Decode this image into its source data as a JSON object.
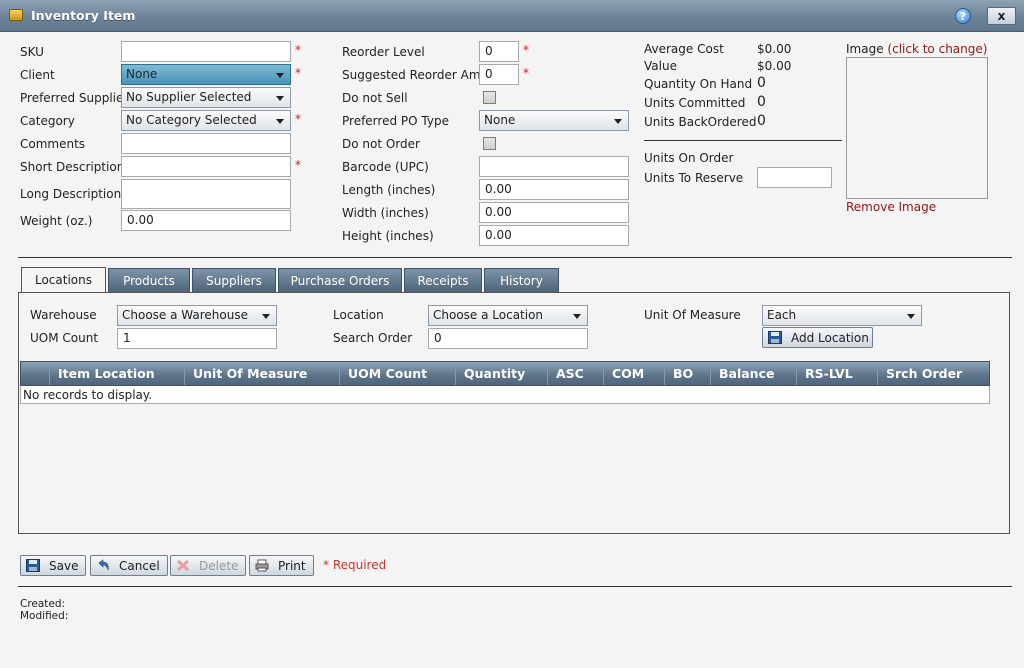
{
  "window": {
    "title": "Inventory Item",
    "help_label": "?",
    "close_label": "x"
  },
  "form": {
    "sku": {
      "label": "SKU",
      "value": ""
    },
    "client": {
      "label": "Client",
      "value": "None"
    },
    "preferred_supplier": {
      "label": "Preferred Supplier",
      "value": "No Supplier Selected"
    },
    "category": {
      "label": "Category",
      "value": "No Category Selected"
    },
    "comments": {
      "label": "Comments",
      "value": ""
    },
    "short_description": {
      "label": "Short Description",
      "value": ""
    },
    "long_description": {
      "label": "Long Description",
      "value": ""
    },
    "weight": {
      "label": "Weight (oz.)",
      "value": "0.00"
    },
    "required_mark": "*",
    "reorder_level": {
      "label": "Reorder Level",
      "value": "0"
    },
    "suggested_reorder_amt": {
      "label": "Suggested Reorder Amt",
      "value": "0"
    },
    "do_not_sell": {
      "label": "Do not Sell",
      "checked": false
    },
    "preferred_po_type": {
      "label": "Preferred PO Type",
      "value": "None"
    },
    "do_not_order": {
      "label": "Do not Order",
      "checked": false
    },
    "barcode": {
      "label": "Barcode (UPC)",
      "value": ""
    },
    "length": {
      "label": "Length (inches)",
      "value": "0.00"
    },
    "width": {
      "label": "Width (inches)",
      "value": "0.00"
    },
    "height": {
      "label": "Height (inches)",
      "value": "0.00"
    }
  },
  "stats": {
    "average_cost": {
      "label": "Average Cost",
      "value": "$0.00"
    },
    "value": {
      "label": "Value",
      "value": "$0.00"
    },
    "quantity_on_hand": {
      "label": "Quantity On Hand",
      "value": "0"
    },
    "units_committed": {
      "label": "Units Committed",
      "value": "0"
    },
    "units_backordered": {
      "label": "Units BackOrdered",
      "value": "0"
    },
    "units_on_order": {
      "label": "Units On Order"
    },
    "units_to_reserve": {
      "label": "Units To Reserve",
      "value": ""
    }
  },
  "image": {
    "label": "Image",
    "change_link": "(click to change)",
    "remove_link": "Remove Image"
  },
  "tabs": [
    {
      "label": "Locations",
      "selected": true
    },
    {
      "label": "Products"
    },
    {
      "label": "Suppliers"
    },
    {
      "label": "Purchase Orders"
    },
    {
      "label": "Receipts"
    },
    {
      "label": "History"
    }
  ],
  "locations": {
    "warehouse": {
      "label": "Warehouse",
      "value": "Choose a Warehouse"
    },
    "uom_count": {
      "label": "UOM Count",
      "value": "1"
    },
    "location": {
      "label": "Location",
      "value": "Choose a Location"
    },
    "search_order": {
      "label": "Search Order",
      "value": "0"
    },
    "unit_of_measure": {
      "label": "Unit Of Measure",
      "value": "Each"
    },
    "add_location_label": "Add Location",
    "grid": {
      "columns": [
        "Item Location",
        "Unit Of Measure",
        "UOM Count",
        "Quantity",
        "ASC",
        "COM",
        "BO",
        "Balance",
        "RS-LVL",
        "Srch Order"
      ],
      "empty_text": "No records to display."
    }
  },
  "buttons": {
    "save": "Save",
    "cancel": "Cancel",
    "delete": "Delete",
    "print": "Print",
    "required_note": "* Required"
  },
  "footer": {
    "created_label": "Created:",
    "modified_label": "Modified:"
  }
}
